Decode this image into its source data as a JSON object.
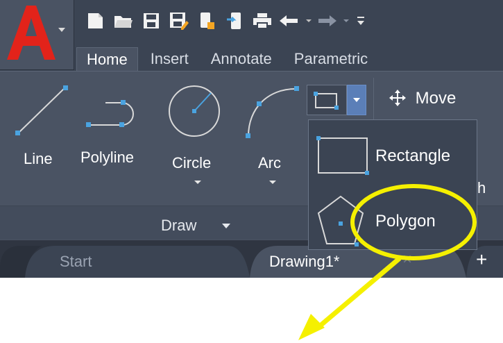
{
  "app": {
    "logo_letter": "A",
    "accent_color": "#e2231a"
  },
  "quick_access": {
    "icons": [
      "new-icon",
      "open-icon",
      "save-icon",
      "save-as-icon",
      "publish-icon",
      "share-icon",
      "print-icon",
      "undo-icon",
      "redo-icon",
      "overflow-icon"
    ]
  },
  "tabs": [
    {
      "label": "Home",
      "active": true
    },
    {
      "label": "Insert",
      "active": false
    },
    {
      "label": "Annotate",
      "active": false
    },
    {
      "label": "Parametric",
      "active": false
    }
  ],
  "draw_panel": {
    "title": "Draw",
    "tools": {
      "line": "Line",
      "polyline": "Polyline",
      "circle": "Circle",
      "arc": "Arc"
    }
  },
  "modify_panel": {
    "move": "Move",
    "partial_label": "h"
  },
  "flyout": {
    "rectangle": "Rectangle",
    "polygon": "Polygon"
  },
  "file_tabs": {
    "start": "Start",
    "drawing": "Drawing1*",
    "new_tab_symbol": "+",
    "close_symbol": "×"
  },
  "annotation": {
    "highlight_color": "#f5f000"
  }
}
